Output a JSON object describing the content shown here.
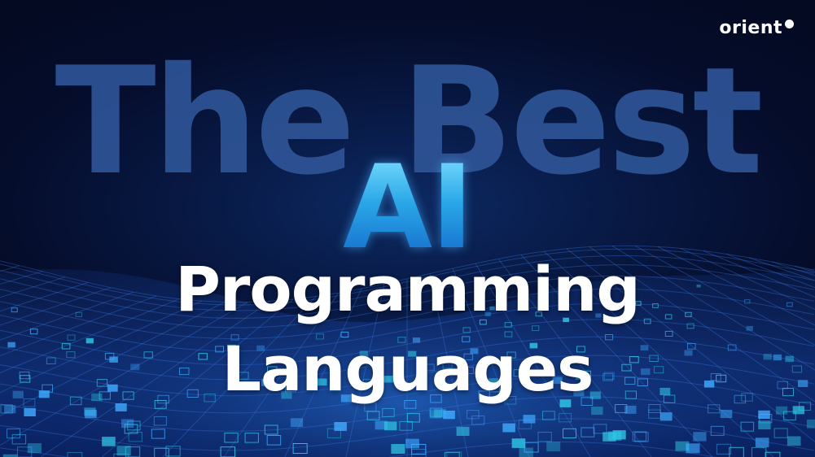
{
  "brand": {
    "logo_text": "orient"
  },
  "headline": {
    "line1": "The Best",
    "line2": "AI",
    "line3": "Programming",
    "line4": "Languages"
  },
  "colors": {
    "background": "#050a24",
    "best_text": "#2e5496",
    "ai_text": "#3fa9e8",
    "main_text": "#ffffff",
    "grid": "#2a6fd6"
  }
}
